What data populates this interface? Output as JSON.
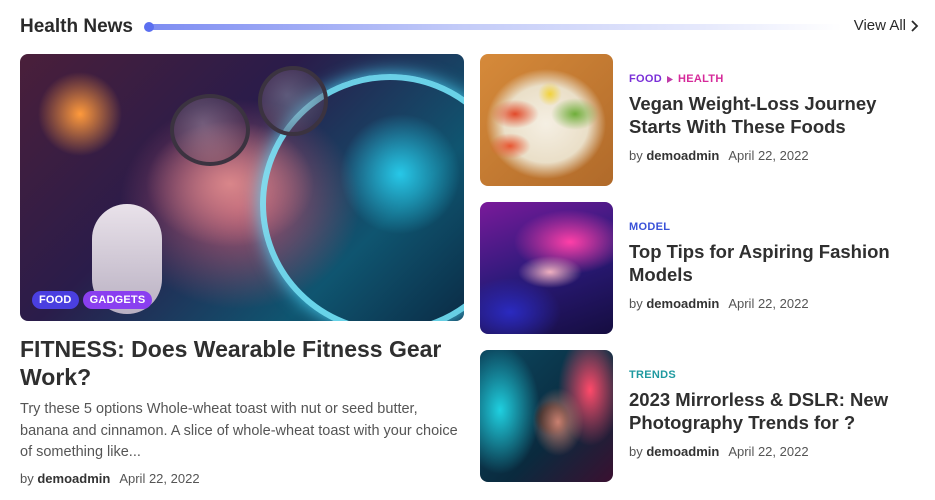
{
  "section": {
    "title": "Health News",
    "view_all_label": "View All"
  },
  "featured": {
    "tags": [
      "FOOD",
      "GADGETS"
    ],
    "title": "FITNESS: Does Wearable Fitness Gear Work?",
    "excerpt": "Try these 5 options Whole-wheat toast with nut or seed butter, banana and cinnamon. A slice of whole-wheat toast with your choice of something like...",
    "by": "by",
    "author": "demoadmin",
    "date": "April 22, 2022"
  },
  "posts": [
    {
      "categories": [
        "FOOD",
        "HEALTH"
      ],
      "category_colors": [
        "#7a2fd8",
        "#d62a9a"
      ],
      "title": "Vegan Weight-Loss Journey Starts With These Foods",
      "by": "by",
      "author": "demoadmin",
      "date": "April 22, 2022"
    },
    {
      "categories": [
        "MODEL"
      ],
      "category_colors": [
        "#3a52d8"
      ],
      "title": "Top Tips for Aspiring Fashion Models",
      "by": "by",
      "author": "demoadmin",
      "date": "April 22, 2022"
    },
    {
      "categories": [
        "TRENDS"
      ],
      "category_colors": [
        "#1f9aa0"
      ],
      "title": "2023 Mirrorless & DSLR: New Photography Trends for ?",
      "by": "by",
      "author": "demoadmin",
      "date": "April 22, 2022"
    }
  ],
  "icons": {
    "view_all": "chevron-right-icon",
    "category_separator": "triangle-right-icon"
  }
}
